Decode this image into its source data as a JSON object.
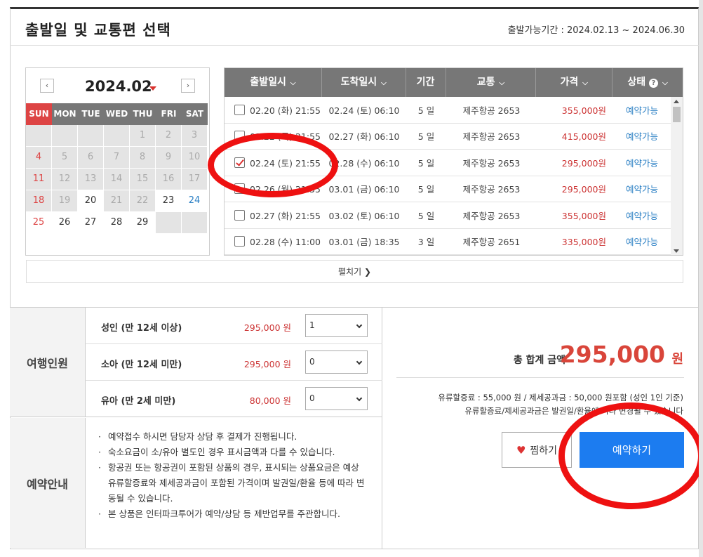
{
  "header": {
    "title": "출발일 및 교통편 선택",
    "period": "출발가능기간 : 2024.02.13 ~ 2024.06.30"
  },
  "calendar": {
    "prev": "‹",
    "next": "›",
    "title": "2024.02",
    "dow": [
      "SUN",
      "MON",
      "TUE",
      "WED",
      "THU",
      "FRI",
      "SAT"
    ],
    "weeks": [
      [
        "",
        "",
        "",
        "",
        "1",
        "2",
        "3"
      ],
      [
        "4",
        "5",
        "6",
        "7",
        "8",
        "9",
        "10"
      ],
      [
        "11",
        "12",
        "13",
        "14",
        "15",
        "16",
        "17"
      ],
      [
        "18",
        "19",
        "20",
        "21",
        "22",
        "23",
        "24"
      ],
      [
        "25",
        "26",
        "27",
        "28",
        "29",
        "",
        ""
      ]
    ],
    "active_days": [
      "20",
      "23",
      "24",
      "25",
      "26",
      "27",
      "28",
      "29"
    ]
  },
  "flights": {
    "headers": [
      "출발일시",
      "도착일시",
      "기간",
      "교통",
      "가격",
      "상태"
    ],
    "rows": [
      {
        "dep": "02.20 (화) 21:55",
        "arr": "02.24 (토) 06:10",
        "dur": "5 일",
        "carrier": "제주항공 2653",
        "price": "355,000원",
        "status": "예약가능",
        "checked": false
      },
      {
        "dep": "02.22 (목) 21:55",
        "arr": "02.27 (화) 06:10",
        "dur": "5 일",
        "carrier": "제주항공 2653",
        "price": "415,000원",
        "status": "예약가능",
        "checked": false
      },
      {
        "dep": "02.24 (토) 21:55",
        "arr": "02.28 (수) 06:10",
        "dur": "5 일",
        "carrier": "제주항공 2653",
        "price": "295,000원",
        "status": "예약가능",
        "checked": true
      },
      {
        "dep": "02.26 (월) 21:55",
        "arr": "03.01 (금) 06:10",
        "dur": "5 일",
        "carrier": "제주항공 2653",
        "price": "295,000원",
        "status": "예약가능",
        "checked": false
      },
      {
        "dep": "02.27 (화) 21:55",
        "arr": "03.02 (토) 06:10",
        "dur": "5 일",
        "carrier": "제주항공 2653",
        "price": "355,000원",
        "status": "예약가능",
        "checked": false
      },
      {
        "dep": "02.28 (수) 11:00",
        "arr": "03.01 (금) 18:35",
        "dur": "3 일",
        "carrier": "제주항공 2651",
        "price": "335,000원",
        "status": "예약가능",
        "checked": false
      }
    ]
  },
  "expand_label": "펼치기",
  "travelers": {
    "label": "여행인원",
    "rows": [
      {
        "label": "성인 (만 12세 이상)",
        "price": "295,000 원",
        "count": "1"
      },
      {
        "label": "소아 (만 12세 미만)",
        "price": "295,000 원",
        "count": "0"
      },
      {
        "label": "유아 (만 2세 미만)",
        "price": "80,000 원",
        "count": "0"
      }
    ]
  },
  "notice": {
    "label": "예약안내",
    "items": [
      "예약접수 하시면 담당자 상담 후 결제가 진행됩니다.",
      "숙소요금이 소/유아 별도인 경우 표시금액과 다를 수 있습니다.",
      "항공권 또는 항공권이 포함된 상품의 경우, 표시되는 상품요금은 예상 유류할증료와 제세공과금이 포함된 가격이며 발권일/환율 등에 따라 변동될 수 있습니다.",
      "본 상품은 인터파크투어가 예약/상담 등 제반업무를 주관합니다."
    ]
  },
  "summary": {
    "total_label": "총 합계 금액",
    "total_amount": "295,000",
    "total_unit": "원",
    "fee_line1": "유류할증료 : 55,000 원 / 제세공과금 : 50,000 원포함 (성인 1인 기준)",
    "fee_line2": "유류할증료/제세공과금은 발권일/환율에 따라 변경될 수 있습니다",
    "wish_label": "찜하기",
    "reserve_label": "예약하기"
  },
  "colors": {
    "accent": "#1c7cf0",
    "price": "#cc3333",
    "annotation": "#ee1111"
  }
}
